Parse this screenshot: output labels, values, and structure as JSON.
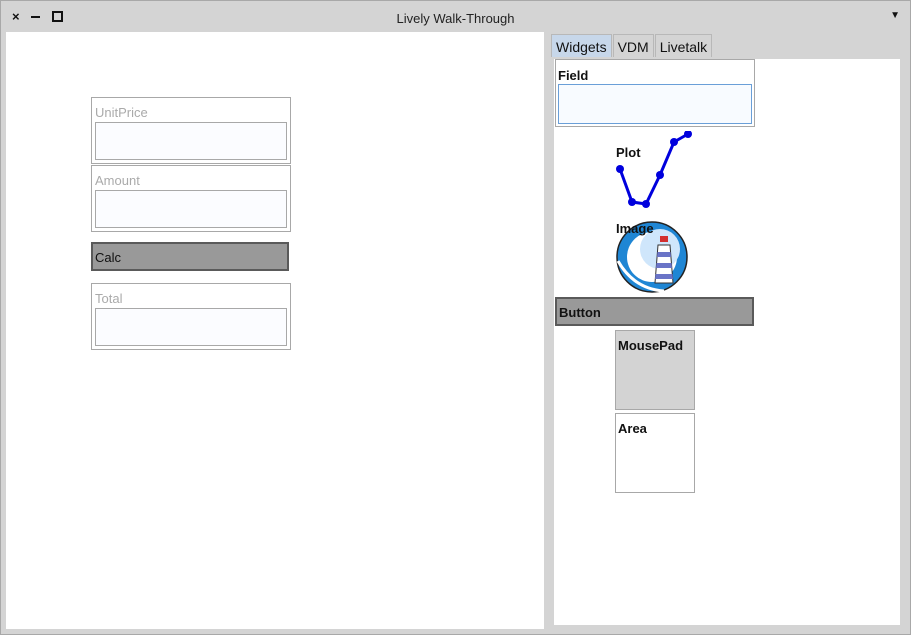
{
  "window": {
    "title": "Lively Walk-Through",
    "close_glyph": "×",
    "menu_glyph": "▼"
  },
  "canvas": {
    "unit_price": {
      "label": "UnitPrice",
      "value": ""
    },
    "amount": {
      "label": "Amount",
      "value": ""
    },
    "calc_button": {
      "label": "Calc"
    },
    "total": {
      "label": "Total",
      "value": ""
    }
  },
  "palette": {
    "tabs": [
      {
        "label": "Widgets",
        "active": true
      },
      {
        "label": "VDM",
        "active": false
      },
      {
        "label": "Livetalk",
        "active": false
      }
    ],
    "items": {
      "field": "Field",
      "plot": "Plot",
      "image": "Image",
      "button": "Button",
      "mousepad": "MousePad",
      "area": "Area"
    }
  },
  "colors": {
    "plot_line": "#0000dd",
    "button_fill": "#999999",
    "tab_active": "#c7d7ea"
  }
}
